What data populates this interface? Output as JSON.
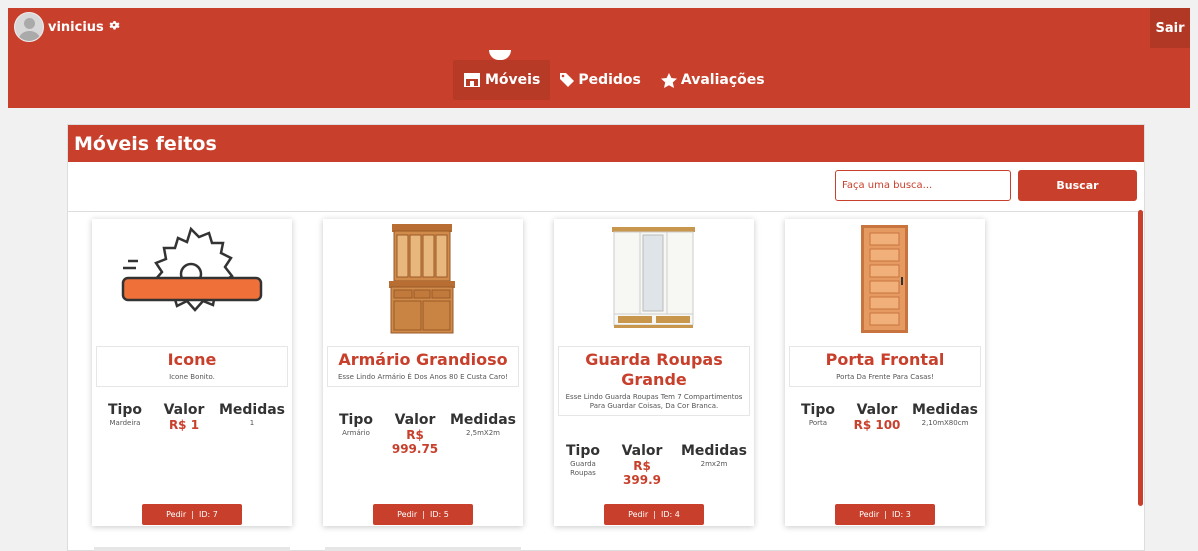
{
  "header": {
    "username": "vinicius",
    "logout_label": "Sair",
    "nav": [
      {
        "label": "Móveis",
        "icon": "store-icon"
      },
      {
        "label": "Pedidos",
        "icon": "tag-icon"
      },
      {
        "label": "Avaliações",
        "icon": "star-icon"
      }
    ]
  },
  "panel": {
    "title": "Móveis feitos",
    "search_placeholder": "Faça uma busca...",
    "search_button": "Buscar"
  },
  "labels": {
    "tipo": "Tipo",
    "valor": "Valor",
    "medidas": "Medidas",
    "pedir": "Pedir"
  },
  "products": [
    {
      "name": "Icone",
      "description": "Icone Bonito.",
      "tipo": "Mardeira",
      "valor": "R$ 1",
      "medidas": "1",
      "id_label": "ID: 7",
      "image": "saw-icon"
    },
    {
      "name": "Armário Grandioso",
      "description": "Esse Lindo Armário É Dos Anos 80 E Custa Caro!",
      "tipo": "Armário",
      "valor": "R$ 999.75",
      "medidas": "2,5mX2m",
      "id_label": "ID: 5",
      "image": "cabinet-image"
    },
    {
      "name": "Guarda Roupas Grande",
      "description": "Esse Lindo Guarda Roupas Tem 7 Compartimentos Para Guardar Coisas, Da Cor Branca.",
      "tipo": "Guarda Roupas",
      "valor": "R$ 399.9",
      "medidas": "2mx2m",
      "id_label": "ID: 4",
      "image": "wardrobe-image"
    },
    {
      "name": "Porta Frontal",
      "description": "Porta Da Frente Para Casas!",
      "tipo": "Porta",
      "valor": "R$ 100",
      "medidas": "2,10mX80cm",
      "id_label": "ID: 3",
      "image": "door-image"
    }
  ],
  "colors": {
    "primary": "#c8402c",
    "primary_dark": "#b23826",
    "saw_orange": "#f0703a"
  }
}
